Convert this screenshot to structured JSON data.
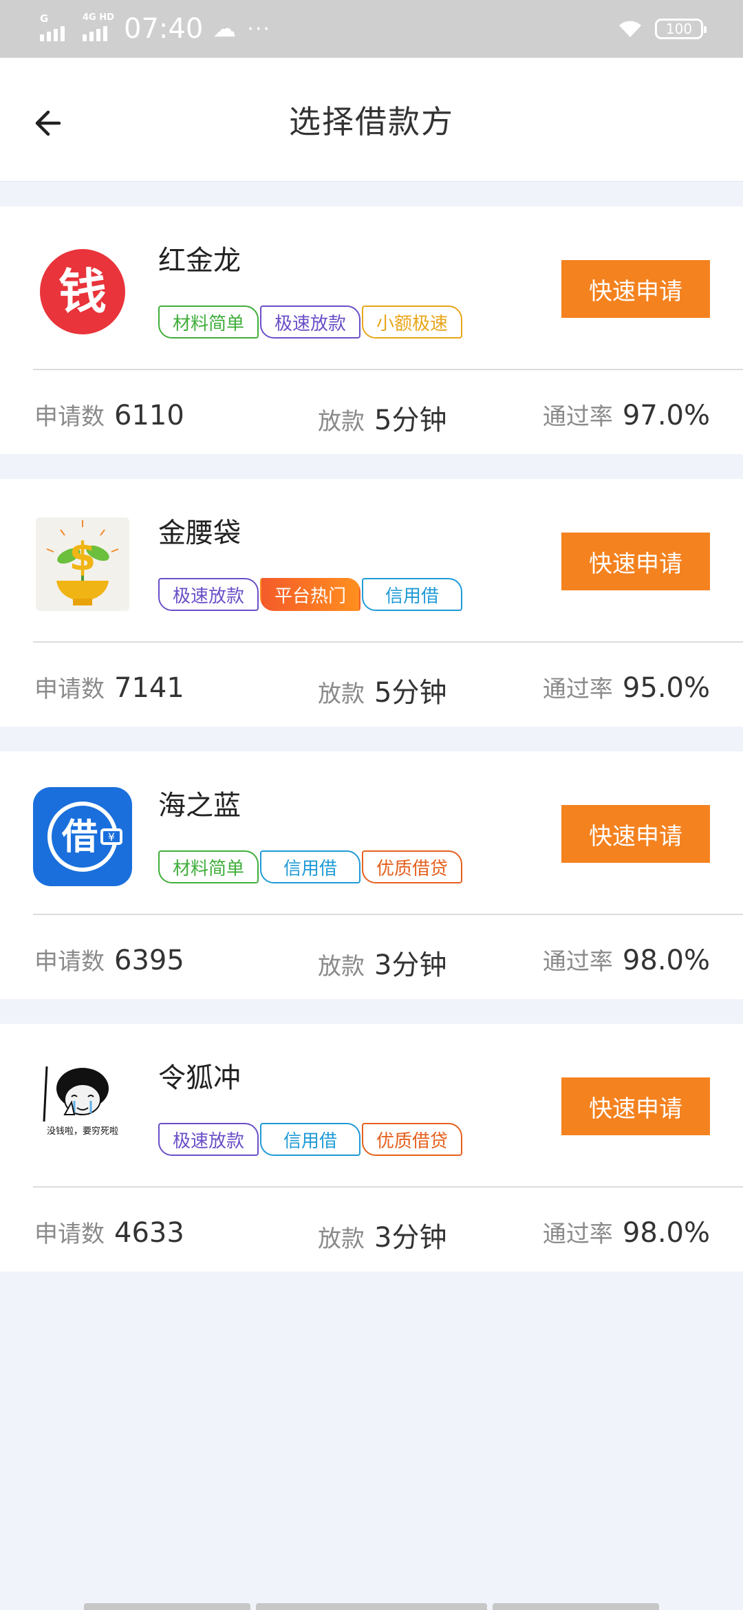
{
  "status_bar": {
    "sim1": "G",
    "sim2": "4G HD",
    "time": "07:40",
    "weather_icon": "cloud-sun-icon",
    "more": "···",
    "battery": "100"
  },
  "header": {
    "title": "选择借款方"
  },
  "colors": {
    "accent": "#f4821f",
    "tag_green": "#3fae3a",
    "tag_purple": "#6a4fc7",
    "tag_yellow": "#e9a51a",
    "tag_blue": "#1e9ad6",
    "tag_orange": "#e5601d"
  },
  "lenders": [
    {
      "name": "红金龙",
      "logo": "red-coin-qian-icon",
      "tags": [
        "材料简单",
        "极速放款",
        "小额极速"
      ],
      "apply": "快速申请",
      "apply_count_label": "申请数",
      "apply_count": "6110",
      "loan_label": "放款",
      "loan_time": "5分钟",
      "pass_label": "通过率",
      "pass_rate": "97.0%"
    },
    {
      "name": "金腰袋",
      "logo": "money-plant-icon",
      "tags": [
        "极速放款",
        "平台热门",
        "信用借"
      ],
      "apply": "快速申请",
      "apply_count_label": "申请数",
      "apply_count": "7141",
      "loan_label": "放款",
      "loan_time": "5分钟",
      "pass_label": "通过率",
      "pass_rate": "95.0%"
    },
    {
      "name": "海之蓝",
      "logo": "blue-jie-icon",
      "tags": [
        "材料简单",
        "信用借",
        "优质借贷"
      ],
      "apply": "快速申请",
      "apply_count_label": "申请数",
      "apply_count": "6395",
      "loan_label": "放款",
      "loan_time": "3分钟",
      "pass_label": "通过率",
      "pass_rate": "98.0%"
    },
    {
      "name": "令狐冲",
      "logo": "meme-face-icon",
      "logo_caption": "没钱啦，要穷死啦",
      "tags": [
        "极速放款",
        "信用借",
        "优质借贷"
      ],
      "apply": "快速申请",
      "apply_count_label": "申请数",
      "apply_count": "4633",
      "loan_label": "放款",
      "loan_time": "3分钟",
      "pass_label": "通过率",
      "pass_rate": "98.0%"
    }
  ]
}
